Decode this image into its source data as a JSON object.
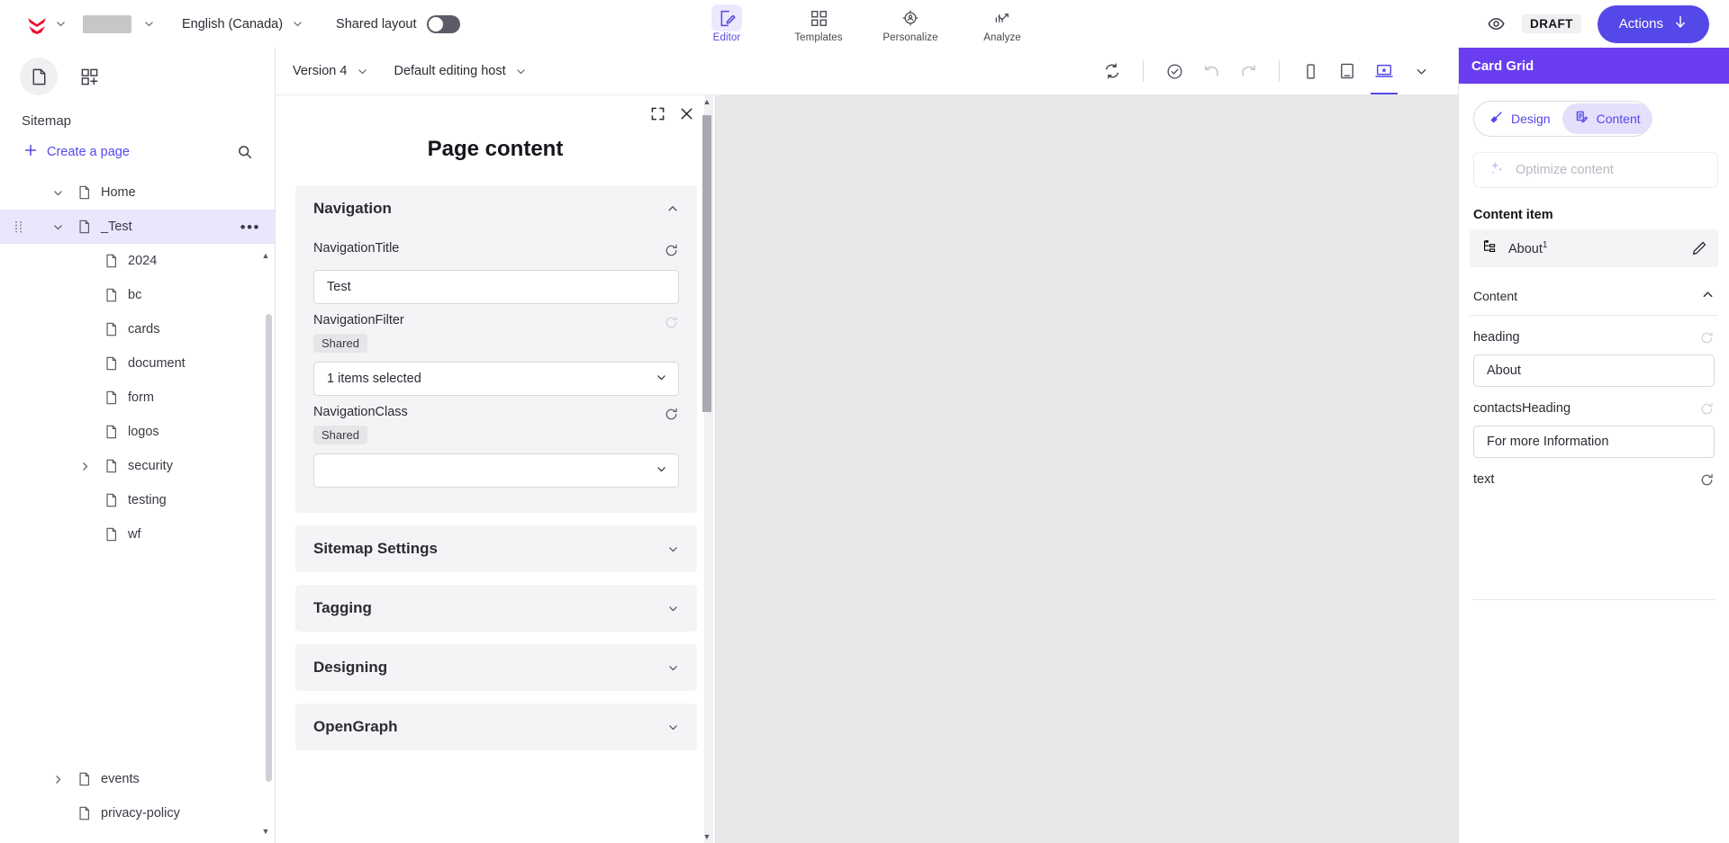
{
  "topbar": {
    "logo": "sitecore-logo",
    "language": "English (Canada)",
    "shared_layout_label": "Shared layout",
    "shared_layout_on": false,
    "nav": [
      {
        "label": "Editor",
        "icon": "editor-icon",
        "active": true
      },
      {
        "label": "Templates",
        "icon": "templates-icon",
        "active": false
      },
      {
        "label": "Personalize",
        "icon": "personalize-icon",
        "active": false
      },
      {
        "label": "Analyze",
        "icon": "analyze-icon",
        "active": false
      }
    ],
    "preview_icon": "eye-icon",
    "status_badge": "DRAFT",
    "actions_label": "Actions",
    "accent_color": "#5548e8"
  },
  "left_panel": {
    "rail": [
      {
        "name": "pages-icon",
        "active": true
      },
      {
        "name": "components-icon",
        "active": false
      }
    ],
    "title": "Sitemap",
    "create_page_label": "Create a page",
    "search_icon": "search-icon",
    "tree": [
      {
        "label": "Home",
        "indent": 0,
        "twisty": "down",
        "selected": false
      },
      {
        "label": "_Test",
        "indent": 0,
        "twisty": "down",
        "selected": true
      },
      {
        "label": "2024",
        "indent": 1,
        "twisty": "none",
        "selected": false
      },
      {
        "label": "bc",
        "indent": 1,
        "twisty": "none",
        "selected": false
      },
      {
        "label": "cards",
        "indent": 1,
        "twisty": "none",
        "selected": false
      },
      {
        "label": "document",
        "indent": 1,
        "twisty": "none",
        "selected": false
      },
      {
        "label": "form",
        "indent": 1,
        "twisty": "none",
        "selected": false
      },
      {
        "label": "logos",
        "indent": 1,
        "twisty": "none",
        "selected": false
      },
      {
        "label": "security",
        "indent": 1,
        "twisty": "right",
        "selected": false
      },
      {
        "label": "testing",
        "indent": 1,
        "twisty": "none",
        "selected": false
      },
      {
        "label": "wf",
        "indent": 1,
        "twisty": "none",
        "selected": false
      }
    ],
    "tree_bottom": [
      {
        "label": "events",
        "indent": 0,
        "twisty": "right",
        "selected": false
      },
      {
        "label": "privacy-policy",
        "indent": 0,
        "twisty": "none",
        "selected": false
      }
    ],
    "row_menu": "•••"
  },
  "canvas_toolbar": {
    "version": "Version 4",
    "editing_host": "Default editing host",
    "icons": [
      {
        "name": "refresh-icon",
        "state": "enabled"
      },
      {
        "name": "check-circle-icon",
        "state": "enabled"
      },
      {
        "name": "undo-icon",
        "state": "disabled"
      },
      {
        "name": "redo-icon",
        "state": "disabled"
      },
      {
        "name": "mobile-icon",
        "state": "enabled"
      },
      {
        "name": "tablet-icon",
        "state": "enabled"
      },
      {
        "name": "desktop-icon",
        "state": "active"
      },
      {
        "name": "chevron-down-icon",
        "state": "enabled"
      }
    ]
  },
  "dialog": {
    "expand_icon": "expand-icon",
    "close_icon": "close-icon",
    "title": "Page content",
    "sections": [
      {
        "name": "Navigation",
        "expanded": true,
        "fields": [
          {
            "label": "NavigationTitle",
            "type": "text",
            "value": "Test",
            "shared": false,
            "reset": "enabled"
          },
          {
            "label": "NavigationFilter",
            "type": "select",
            "value": "1 items selected",
            "shared": true,
            "shared_label": "Shared",
            "reset": "faded"
          },
          {
            "label": "NavigationClass",
            "type": "select",
            "value": "",
            "shared": true,
            "shared_label": "Shared",
            "reset": "enabled"
          }
        ]
      },
      {
        "name": "Sitemap Settings",
        "expanded": false,
        "fields": []
      },
      {
        "name": "Tagging",
        "expanded": false,
        "fields": []
      },
      {
        "name": "Designing",
        "expanded": false,
        "fields": []
      },
      {
        "name": "OpenGraph",
        "expanded": false,
        "fields": []
      }
    ]
  },
  "right_panel": {
    "header_title": "Card Grid",
    "header_color": "#6a3df0",
    "segmented": [
      {
        "label": "Design",
        "icon": "brush-icon",
        "active": false
      },
      {
        "label": "Content",
        "icon": "content-icon",
        "active": true
      }
    ],
    "optimize_label": "Optimize content",
    "optimize_icon": "sparkle-icon",
    "content_item_label": "Content item",
    "content_item": {
      "name": "About",
      "superscript": "1",
      "icon": "item-tree-icon",
      "edit_icon": "pencil-icon"
    },
    "content_accordion": {
      "label": "Content",
      "expanded": true
    },
    "fields": [
      {
        "label": "heading",
        "value": "About",
        "reset": "faded"
      },
      {
        "label": "contactsHeading",
        "value": "For more Information",
        "reset": "faded"
      },
      {
        "label": "text",
        "value": null,
        "reset": "enabled"
      }
    ]
  }
}
